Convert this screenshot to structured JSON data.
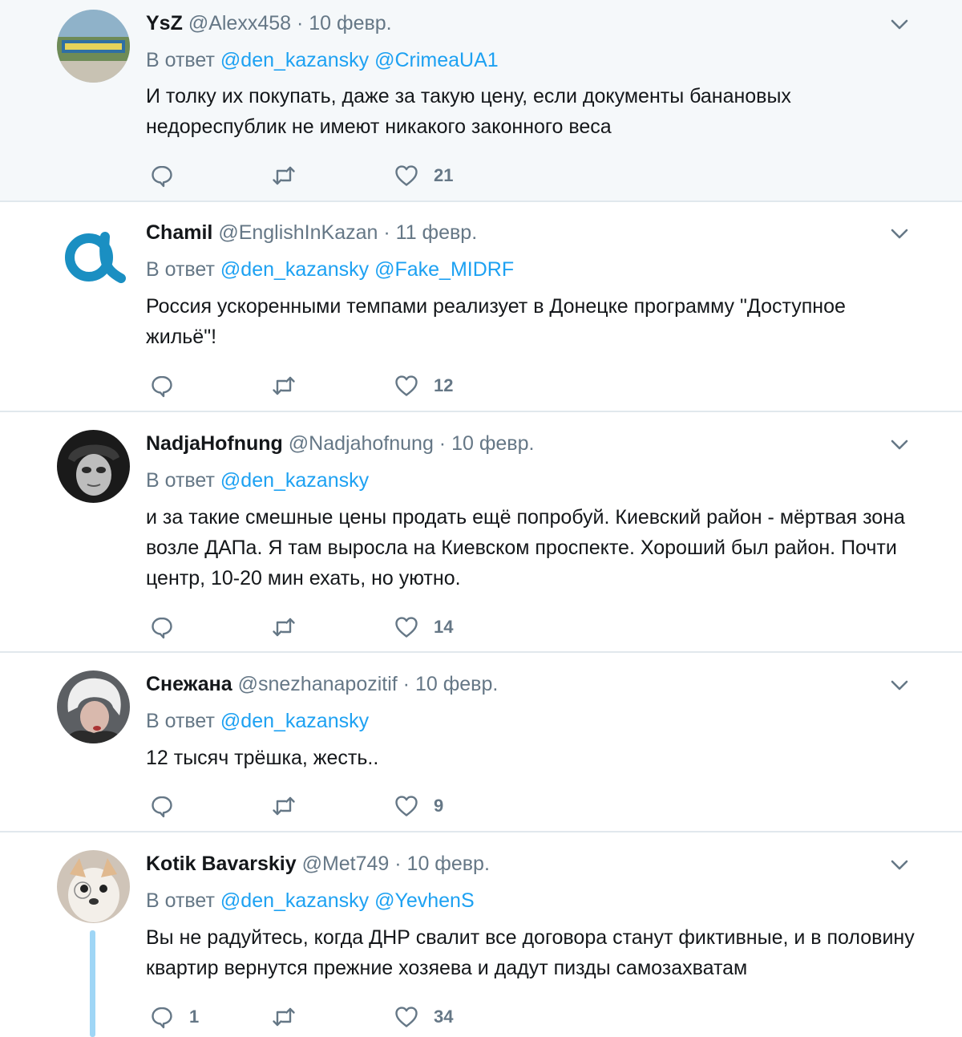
{
  "reply_prefix": "В ответ",
  "tweets": [
    {
      "name": "YsZ",
      "handle": "@Alexx458",
      "dot": " · ",
      "date": "10 февр.",
      "mentions": [
        "@den_kazansky",
        "@CrimeaUA1"
      ],
      "text": "И толку их покупать, даже за такую цену, если документы банановых недореспублик не имеют никакого законного веса",
      "replies": "",
      "retweets": "",
      "likes": "21"
    },
    {
      "name": "Chamil",
      "handle": "@EnglishInKazan",
      "dot": " · ",
      "date": "11 февр.",
      "mentions": [
        "@den_kazansky",
        "@Fake_MIDRF"
      ],
      "text": "Россия ускоренными темпами реализует в Донецке программу \"Доступное жильё\"!",
      "replies": "",
      "retweets": "",
      "likes": "12"
    },
    {
      "name": "NadjaHofnung",
      "handle": "@Nadjahofnung",
      "dot": " · ",
      "date": "10 февр.",
      "mentions": [
        "@den_kazansky"
      ],
      "text": "и за такие смешные цены продать ещё попробуй. Киевский район - мёртвая зона возле ДАПа. Я там выросла на Киевском проспекте. Хороший был район. Почти центр, 10-20 мин ехать, но уютно.",
      "replies": "",
      "retweets": "",
      "likes": "14"
    },
    {
      "name": "Снежана",
      "handle": "@snezhanapozitif",
      "dot": " · ",
      "date": "10 февр.",
      "mentions": [
        "@den_kazansky"
      ],
      "text": "12 тысяч трёшка, жесть..",
      "replies": "",
      "retweets": "",
      "likes": "9"
    },
    {
      "name": "Kotik Bavarskiy",
      "handle": "@Met749",
      "dot": " · ",
      "date": "10 февр.",
      "mentions": [
        "@den_kazansky",
        "@YevhenS"
      ],
      "text": "Вы не радуйтесь, когда ДНР свалит все договора станут фиктивные, и в половину квартир вернутся прежние хозяева и дадут пизды самозахватам",
      "replies": "1",
      "retweets": "",
      "likes": "34"
    }
  ],
  "colors": {
    "link": "#1da1f2",
    "muted": "#657786",
    "text": "#14171a",
    "highlight_bg": "#f5f8fa",
    "divider": "#e1e8ed",
    "thread_line": "#9fd6f6"
  },
  "icons": {
    "reply": "reply-icon",
    "retweet": "retweet-icon",
    "like": "heart-icon",
    "menu": "chevron-down-icon"
  }
}
